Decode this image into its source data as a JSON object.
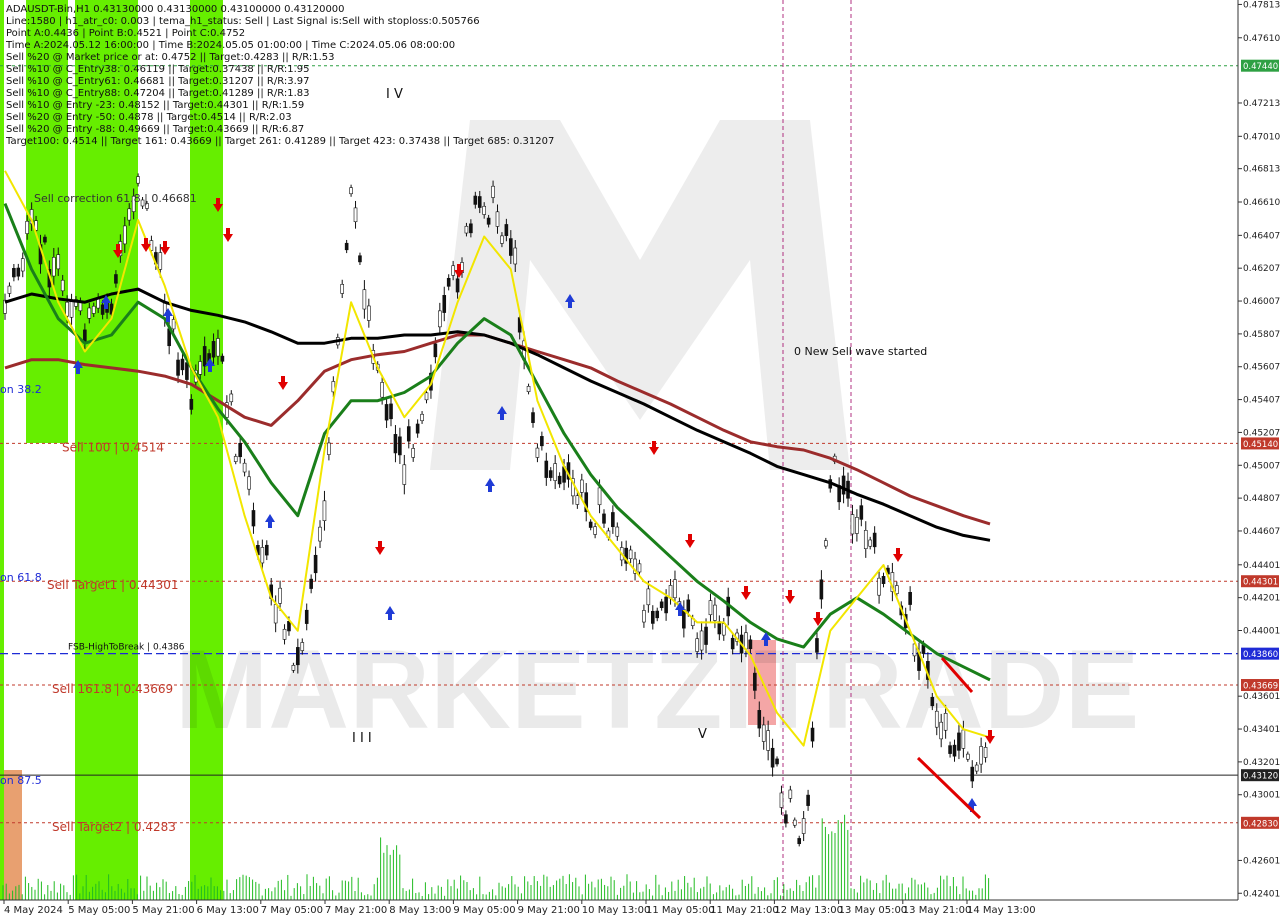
{
  "header": {
    "lines": [
      "ADAUSDT-Bin,H1  0.43130000 0.43130000 0.43100000 0.43120000",
      "Line:1580 | h1_atr_c0: 0.003 | tema_h1_status: Sell | Last Signal is:Sell with stoploss:0.505766",
      "Point A:0.4436 | Point B:0.4521 | Point C:0.4752",
      "Time A:2024.05.12 16:00:00 | Time B:2024.05.05 01:00:00 | Time C:2024.05.06 08:00:00",
      "Sell %20 @ Market price or at: 0.4752 || Target:0.4283 || R/R:1.53",
      "Sell %10 @ C_Entry38: 0.46119 || Target:0.37438 || R/R:1.95",
      "Sell %10 @ C_Entry61: 0.46681 || Target:0.31207 || R/R:3.97",
      "Sell %10 @ C_Entry88: 0.47204 || Target:0.41289 || R/R:1.83",
      "Sell %10 @ Entry -23: 0.48152 || Target:0.44301 || R/R:1.59",
      "Sell %20 @ Entry -50: 0.4878 || Target:0.4514 || R/R:2.03",
      "Sell %20 @ Entry -88: 0.49669 || Target:0.43669 || R/R:6.87",
      "Target100: 0.4514 || Target 161: 0.43669 || Target 261: 0.41289 || Target 423: 0.37438 || Target 685: 0.31207"
    ]
  },
  "watermark": "MARKETZITRADE",
  "annotations": {
    "sell_correction": "Sell correction 61.8 | 0.46681",
    "new_sell_wave": "0 New Sell wave started",
    "wave_iv": "I V",
    "wave_iii": "I I I",
    "wave_v": "V",
    "fib_382": "on 38.2",
    "fib_618": "on 61.8",
    "fib_875": "on 87.5"
  },
  "levels": {
    "sell100": {
      "label": "Sell 100 | 0.4514",
      "price": 0.4514,
      "tag": "0.45140",
      "color": "#c0392b"
    },
    "target1": {
      "label": "Sell Target1 | 0.44301",
      "price": 0.44301,
      "tag": "0.44301",
      "color": "#c0392b"
    },
    "fsb": {
      "label": "FSB-HighToBreak | 0.4386",
      "price": 0.4386,
      "tag": "0.43860",
      "color": "#1f2bd6"
    },
    "s1618": {
      "label": "Sell 161.8 | 0.43669",
      "price": 0.43669,
      "tag": "0.43669",
      "color": "#c0392b"
    },
    "target2": {
      "label": "Sell Target2 | 0.4283",
      "price": 0.4283,
      "tag": "0.42830",
      "color": "#c0392b"
    },
    "green": {
      "price": 0.4744,
      "tag": "0.47440",
      "color": "#2ea043"
    },
    "current": {
      "price": 0.4312,
      "tag": "0.43120",
      "color": "#222222"
    }
  },
  "chart_data": {
    "type": "line",
    "title": "ADAUSDT-Bin,H1",
    "ylim": [
      0.4236,
      0.4784
    ],
    "y_ticks": [
      "0.47813",
      "0.47610",
      "0.47213",
      "0.47010",
      "0.46813",
      "0.46610",
      "0.46407",
      "0.46207",
      "0.46007",
      "0.45807",
      "0.45607",
      "0.45407",
      "0.45207",
      "0.45007",
      "0.44807",
      "0.44607",
      "0.44401",
      "0.44201",
      "0.44001",
      "0.43601",
      "0.43401",
      "0.43201",
      "0.43001",
      "0.42601",
      "0.42401"
    ],
    "x_ticks": [
      "4 May 2024",
      "5 May 05:00",
      "5 May 21:00",
      "6 May 13:00",
      "7 May 05:00",
      "7 May 21:00",
      "8 May 13:00",
      "9 May 05:00",
      "9 May 21:00",
      "10 May 13:00",
      "11 May 05:00",
      "11 May 21:00",
      "12 May 13:00",
      "13 May 05:00",
      "13 May 21:00",
      "14 May 13:00"
    ],
    "series": [
      {
        "key": "close",
        "color": "#111111",
        "values": [
          0.46,
          0.464,
          0.462,
          0.458,
          0.46,
          0.468,
          0.46,
          0.454,
          0.457,
          0.449,
          0.443,
          0.438,
          0.448,
          0.466,
          0.456,
          0.45,
          0.456,
          0.462,
          0.4665,
          0.464,
          0.451,
          0.449,
          0.4475,
          0.446,
          0.442,
          0.442,
          0.4395,
          0.441,
          0.438,
          0.431,
          0.427,
          0.45,
          0.447,
          0.443,
          0.441,
          0.435,
          0.4325,
          0.4312
        ]
      },
      {
        "key": "ma_brown",
        "color": "#9b2c2c",
        "values": [
          0.456,
          0.4565,
          0.4565,
          0.4562,
          0.456,
          0.4558,
          0.4555,
          0.455,
          0.454,
          0.453,
          0.4525,
          0.454,
          0.4558,
          0.4565,
          0.4568,
          0.457,
          0.4575,
          0.458,
          0.458,
          0.4575,
          0.457,
          0.4565,
          0.456,
          0.4552,
          0.4545,
          0.4538,
          0.453,
          0.4522,
          0.4515,
          0.4512,
          0.451,
          0.4505,
          0.4498,
          0.449,
          0.4482,
          0.4476,
          0.447,
          0.4465
        ]
      },
      {
        "key": "ma_black",
        "color": "#000000",
        "values": [
          0.46,
          0.4605,
          0.4602,
          0.46,
          0.4605,
          0.4608,
          0.46,
          0.4595,
          0.4592,
          0.4588,
          0.4582,
          0.4575,
          0.4575,
          0.4578,
          0.4578,
          0.458,
          0.458,
          0.4582,
          0.458,
          0.4575,
          0.4568,
          0.456,
          0.4552,
          0.4545,
          0.4538,
          0.453,
          0.4522,
          0.4515,
          0.4508,
          0.45,
          0.4495,
          0.449,
          0.4483,
          0.4477,
          0.447,
          0.4463,
          0.4458,
          0.4455
        ]
      },
      {
        "key": "ma_green",
        "color": "#1a7f1a",
        "values": [
          0.466,
          0.462,
          0.459,
          0.4575,
          0.458,
          0.46,
          0.459,
          0.456,
          0.4535,
          0.4515,
          0.449,
          0.447,
          0.452,
          0.454,
          0.454,
          0.4545,
          0.4555,
          0.4575,
          0.459,
          0.458,
          0.455,
          0.452,
          0.4495,
          0.4475,
          0.446,
          0.4445,
          0.443,
          0.4418,
          0.4405,
          0.4395,
          0.439,
          0.441,
          0.442,
          0.441,
          0.4398,
          0.4386,
          0.4378,
          0.437
        ]
      },
      {
        "key": "ema_yellow",
        "color": "#f2e600",
        "values": [
          0.468,
          0.465,
          0.46,
          0.457,
          0.459,
          0.465,
          0.461,
          0.456,
          0.453,
          0.447,
          0.442,
          0.44,
          0.451,
          0.46,
          0.456,
          0.453,
          0.455,
          0.46,
          0.464,
          0.462,
          0.454,
          0.45,
          0.447,
          0.445,
          0.443,
          0.442,
          0.4405,
          0.4405,
          0.4385,
          0.435,
          0.433,
          0.44,
          0.442,
          0.444,
          0.44,
          0.436,
          0.434,
          0.4335
        ]
      }
    ]
  }
}
